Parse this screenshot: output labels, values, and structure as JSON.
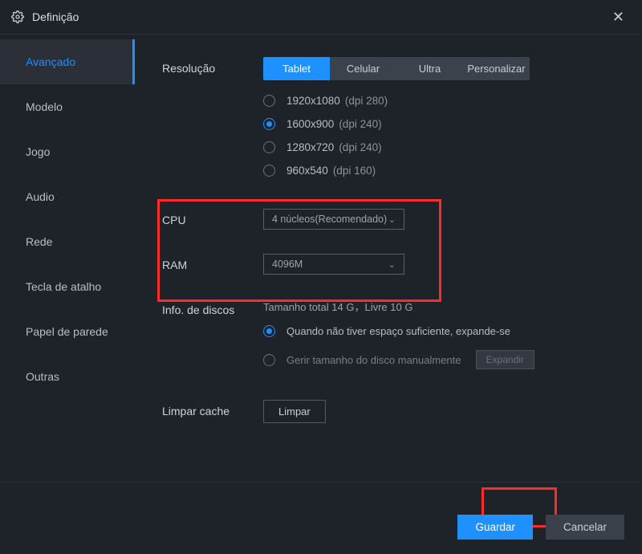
{
  "window": {
    "title": "Definição"
  },
  "sidebar": {
    "items": [
      {
        "label": "Avançado",
        "active": true
      },
      {
        "label": "Modelo",
        "active": false
      },
      {
        "label": "Jogo",
        "active": false
      },
      {
        "label": "Audio",
        "active": false
      },
      {
        "label": "Rede",
        "active": false
      },
      {
        "label": "Tecla de atalho",
        "active": false
      },
      {
        "label": "Papel de parede",
        "active": false
      },
      {
        "label": "Outras",
        "active": false
      }
    ]
  },
  "resolution": {
    "label": "Resolução",
    "tabs": [
      {
        "label": "Tablet",
        "active": true
      },
      {
        "label": "Celular",
        "active": false
      },
      {
        "label": "Ultra",
        "active": false
      },
      {
        "label": "Personalizar",
        "active": false
      }
    ],
    "options": [
      {
        "res": "1920x1080",
        "dpi": "(dpi 280)",
        "selected": false
      },
      {
        "res": "1600x900",
        "dpi": "(dpi 240)",
        "selected": true
      },
      {
        "res": "1280x720",
        "dpi": "(dpi 240)",
        "selected": false
      },
      {
        "res": "960x540",
        "dpi": "(dpi 160)",
        "selected": false
      }
    ]
  },
  "cpu": {
    "label": "CPU",
    "value": "4 núcleos(Recomendado)"
  },
  "ram": {
    "label": "RAM",
    "value": "4096M"
  },
  "disk": {
    "label": "Info. de discos",
    "summary": "Tamanho total 14 G，Livre 10 G",
    "options": [
      {
        "label": "Quando não tiver espaço suficiente, expande-se",
        "selected": true
      },
      {
        "label": "Gerir tamanho do disco manualmente",
        "selected": false
      }
    ],
    "expand_label": "Expandir"
  },
  "cache": {
    "label": "Limpar cache",
    "button": "Limpar"
  },
  "footer": {
    "save": "Guardar",
    "cancel": "Cancelar"
  }
}
